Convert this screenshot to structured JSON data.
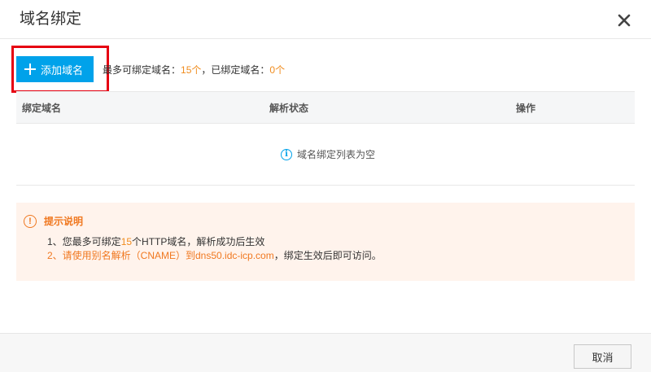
{
  "dialog": {
    "title": "域名绑定",
    "close_icon": "close-icon"
  },
  "toolbar": {
    "add_label": "添加域名",
    "quota_prefix": "最多可绑定域名：",
    "quota_max": "15个",
    "quota_mid": "，已绑定域名：",
    "quota_bound": "0个"
  },
  "table": {
    "columns": [
      "绑定域名",
      "解析状态",
      "操作"
    ],
    "empty_text": "域名绑定列表为空"
  },
  "tips": {
    "title": "提示说明",
    "line1_a": "1、您最多可绑定",
    "line1_num": "15",
    "line1_b": "个HTTP域名，解析成功后生效",
    "line2_a": "2、请使用别名解析（CNAME）到dns50.idc-icp.com",
    "line2_b": "，绑定生效后即可访问。"
  },
  "footer": {
    "cancel_label": "取消"
  },
  "colors": {
    "accent": "#00a2ea",
    "highlight": "#e60012",
    "orange": "#f08c1e",
    "tips_bg": "#fff3ec"
  }
}
